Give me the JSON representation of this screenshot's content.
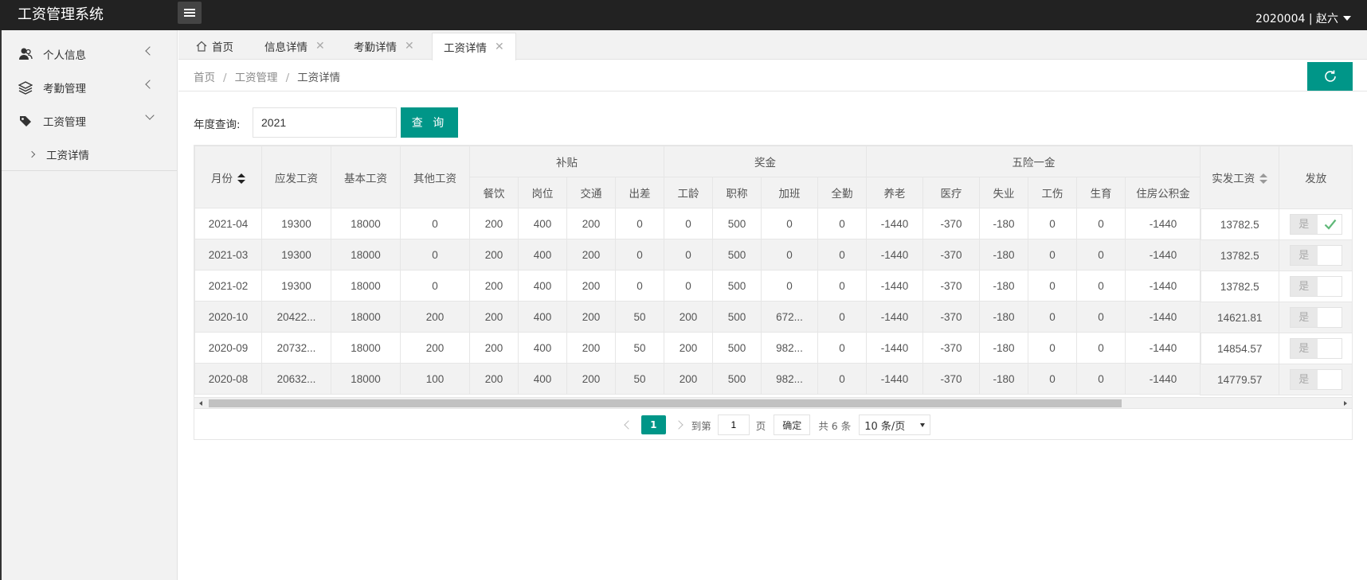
{
  "app": {
    "title": "工资管理系统",
    "user": "2020004 | 赵六"
  },
  "sidebar": {
    "items": [
      {
        "label": "个人信息",
        "icon": "users-icon"
      },
      {
        "label": "考勤管理",
        "icon": "layers-icon"
      },
      {
        "label": "工资管理",
        "icon": "tag-icon"
      }
    ],
    "sub_items": [
      {
        "label": "工资详情"
      }
    ]
  },
  "tabs": [
    {
      "label": "首页"
    },
    {
      "label": "信息详情"
    },
    {
      "label": "考勤详情"
    },
    {
      "label": "工资详情"
    }
  ],
  "breadcrumb": {
    "home": "首页",
    "section": "工资管理",
    "current": "工资详情",
    "sep": "/"
  },
  "query": {
    "label": "年度查询:",
    "value": "2021",
    "button": "查 询"
  },
  "table": {
    "headers": {
      "month": "月份",
      "gross": "应发工资",
      "base": "基本工资",
      "other": "其他工资",
      "subsidy": "补贴",
      "bonus": "奖金",
      "insurance": "五险一金",
      "net": "实发工资",
      "paid": "发放"
    },
    "subsidy_cols": [
      "餐饮",
      "岗位",
      "交通",
      "出差"
    ],
    "bonus_cols": [
      "工龄",
      "职称",
      "加班",
      "全勤"
    ],
    "insurance_cols": [
      "养老",
      "医疗",
      "失业",
      "工伤",
      "生育",
      "住房公积金"
    ],
    "rows": [
      {
        "month": "2021-04",
        "gross": "19300",
        "base": "18000",
        "other": "0",
        "s1": "200",
        "s2": "400",
        "s3": "200",
        "s4": "0",
        "b1": "0",
        "b2": "500",
        "b3": "0",
        "b4": "0",
        "i1": "-1440",
        "i2": "-370",
        "i3": "-180",
        "i4": "0",
        "i5": "0",
        "i6": "-1440",
        "net": "13782.5",
        "switch": "是",
        "paid": true
      },
      {
        "month": "2021-03",
        "gross": "19300",
        "base": "18000",
        "other": "0",
        "s1": "200",
        "s2": "400",
        "s3": "200",
        "s4": "0",
        "b1": "0",
        "b2": "500",
        "b3": "0",
        "b4": "0",
        "i1": "-1440",
        "i2": "-370",
        "i3": "-180",
        "i4": "0",
        "i5": "0",
        "i6": "-1440",
        "net": "13782.5",
        "switch": "是",
        "paid": false
      },
      {
        "month": "2021-02",
        "gross": "19300",
        "base": "18000",
        "other": "0",
        "s1": "200",
        "s2": "400",
        "s3": "200",
        "s4": "0",
        "b1": "0",
        "b2": "500",
        "b3": "0",
        "b4": "0",
        "i1": "-1440",
        "i2": "-370",
        "i3": "-180",
        "i4": "0",
        "i5": "0",
        "i6": "-1440",
        "net": "13782.5",
        "switch": "是",
        "paid": false
      },
      {
        "month": "2020-10",
        "gross": "20422...",
        "base": "18000",
        "other": "200",
        "s1": "200",
        "s2": "400",
        "s3": "200",
        "s4": "50",
        "b1": "200",
        "b2": "500",
        "b3": "672...",
        "b4": "0",
        "i1": "-1440",
        "i2": "-370",
        "i3": "-180",
        "i4": "0",
        "i5": "0",
        "i6": "-1440",
        "net": "14621.81",
        "switch": "是",
        "paid": false
      },
      {
        "month": "2020-09",
        "gross": "20732...",
        "base": "18000",
        "other": "200",
        "s1": "200",
        "s2": "400",
        "s3": "200",
        "s4": "50",
        "b1": "200",
        "b2": "500",
        "b3": "982...",
        "b4": "0",
        "i1": "-1440",
        "i2": "-370",
        "i3": "-180",
        "i4": "0",
        "i5": "0",
        "i6": "-1440",
        "net": "14854.57",
        "switch": "是",
        "paid": false
      },
      {
        "month": "2020-08",
        "gross": "20632...",
        "base": "18000",
        "other": "100",
        "s1": "200",
        "s2": "400",
        "s3": "200",
        "s4": "50",
        "b1": "200",
        "b2": "500",
        "b3": "982...",
        "b4": "0",
        "i1": "-1440",
        "i2": "-370",
        "i3": "-180",
        "i4": "0",
        "i5": "0",
        "i6": "-1440",
        "net": "14779.57",
        "switch": "是",
        "paid": false
      }
    ]
  },
  "pager": {
    "current_page": "1",
    "goto_label": "到第",
    "goto_value": "1",
    "page_unit": "页",
    "ok": "确定",
    "total": "共 6 条",
    "page_size": "10 条/页"
  },
  "colors": {
    "accent": "#009688",
    "header_bg": "#222222",
    "sidebar_bg": "#f2f2f2"
  }
}
